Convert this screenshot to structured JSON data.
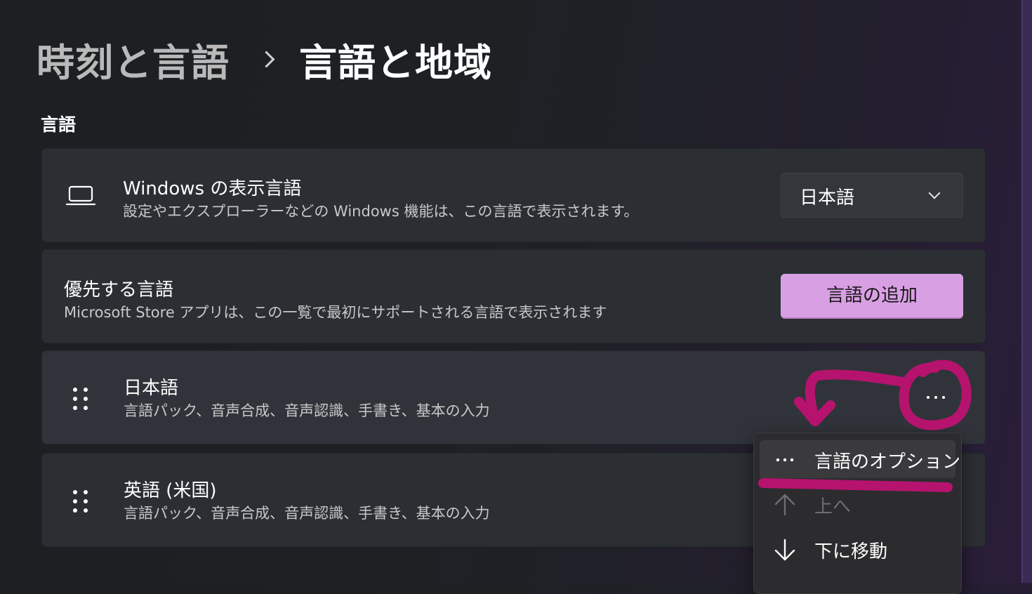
{
  "breadcrumb": {
    "parent": "時刻と言語",
    "current": "言語と地域"
  },
  "section": {
    "title": "言語"
  },
  "display_language": {
    "title": "Windows の表示言語",
    "description": "設定やエクスプローラーなどの Windows 機能は、この言語で表示されます。",
    "selected_value": "日本語",
    "icon": "laptop-icon"
  },
  "preferred_languages": {
    "title": "優先する言語",
    "description": "Microsoft Store アプリは、この一覧で最初にサポートされる言語で表示されます",
    "add_button_label": "言語の追加"
  },
  "languages": [
    {
      "name": "日本語",
      "features": "言語パック、音声合成、音声認識、手書き、基本の入力"
    },
    {
      "name": "英語 (米国)",
      "features": "言語パック、音声合成、音声認識、手書き、基本の入力"
    }
  ],
  "context_menu": {
    "items": [
      {
        "label": "言語のオプション",
        "icon": "more-icon",
        "state": "highlighted"
      },
      {
        "label": "上へ",
        "icon": "arrow-up-icon",
        "state": "disabled"
      },
      {
        "label": "下に移動",
        "icon": "arrow-down-icon",
        "state": "enabled"
      }
    ]
  },
  "colors": {
    "accent": "#d99fe3",
    "annotation": "#b5136e",
    "card": "#2b2f33"
  }
}
